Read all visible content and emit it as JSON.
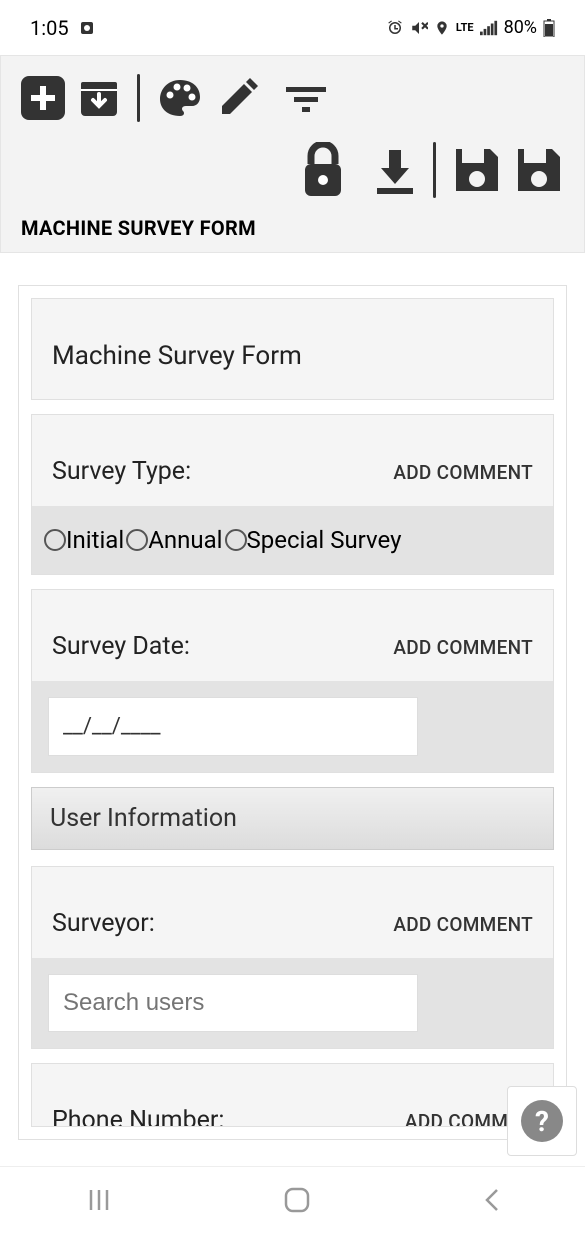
{
  "status_bar": {
    "time": "1:05",
    "battery": "80%",
    "lte_label": "LTE"
  },
  "header": {
    "title": "MACHINE SURVEY FORM"
  },
  "form": {
    "title": "Machine Survey Form",
    "survey_type": {
      "label": "Survey Type:",
      "add_comment": "ADD COMMENT",
      "options": [
        "Initial",
        "Annual",
        "Special Survey"
      ]
    },
    "survey_date": {
      "label": "Survey Date:",
      "add_comment": "ADD COMMENT",
      "value": "__/__/____"
    },
    "user_info_section": "User Information",
    "surveyor": {
      "label": "Surveyor:",
      "add_comment": "ADD COMMENT",
      "placeholder": "Search users"
    },
    "phone": {
      "label": "Phone Number:",
      "add_comment": "ADD COMMEN"
    }
  },
  "help_label": "?"
}
